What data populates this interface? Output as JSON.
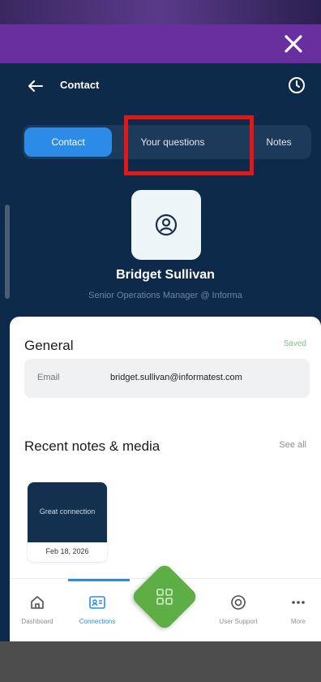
{
  "header": {
    "title": "Contact"
  },
  "tabs": [
    {
      "label": "Contact",
      "active": true
    },
    {
      "label": "Your questions",
      "active": false
    },
    {
      "label": "Notes",
      "active": false
    }
  ],
  "contact": {
    "name": "Bridget Sullivan",
    "role": "Senior Operations Manager @ Informa"
  },
  "general": {
    "title": "General",
    "status": "Saved",
    "email_label": "Email",
    "email_value": "bridget.sullivan@informatest.com"
  },
  "notes": {
    "title": "Recent notes & media",
    "see_all": "See all",
    "items": [
      {
        "text": "Great connection",
        "date": "Feb 18, 2026"
      }
    ]
  },
  "nav": {
    "items": [
      {
        "label": "Dashboard",
        "icon": "home-icon"
      },
      {
        "label": "Connections",
        "icon": "contact-card-icon",
        "active": true
      },
      {
        "label": "User Support",
        "icon": "support-icon"
      },
      {
        "label": "More",
        "icon": "more-icon"
      }
    ],
    "center_icon": "scan-icon"
  },
  "colors": {
    "brand_purple": "#6a2f9e",
    "navy": "#0e2a4a",
    "accent_blue": "#2b8be6",
    "green": "#5cae45",
    "highlight_red": "#e01818"
  }
}
